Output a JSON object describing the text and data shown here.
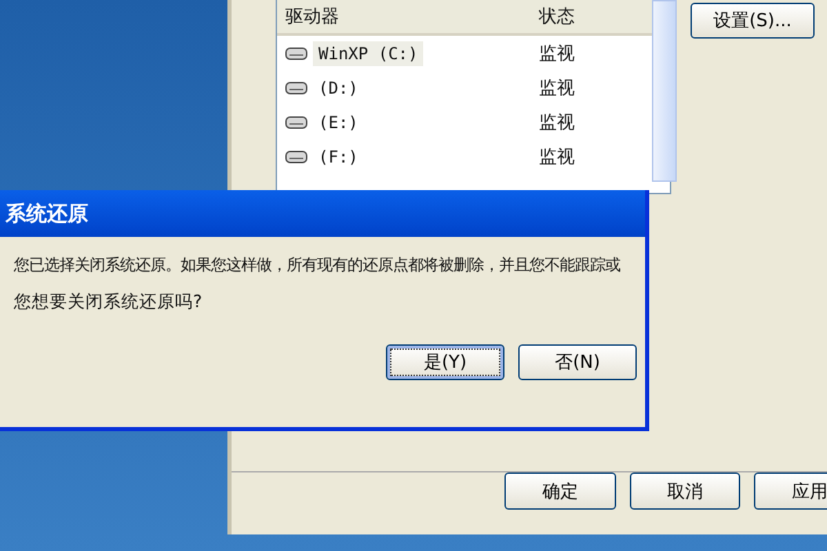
{
  "properties_window": {
    "drive_list": {
      "columns": [
        "驱动器",
        "状态"
      ],
      "rows": [
        {
          "drive": "WinXP (C:)",
          "status": "监视",
          "selected": true
        },
        {
          "drive": "(D:)",
          "status": "监视",
          "selected": false
        },
        {
          "drive": "(E:)",
          "status": "监视",
          "selected": false
        },
        {
          "drive": "(F:)",
          "status": "监视",
          "selected": false
        }
      ]
    },
    "settings_button": "设置(S)...",
    "buttons": [
      "确定",
      "取消",
      "应用"
    ]
  },
  "dialog": {
    "title": "系统还原",
    "message": "您已选择关闭系统还原。如果您这样做，所有现有的还原点都将被删除，并且您不能跟踪或",
    "question": "您想要关闭系统还原吗?",
    "buttons": [
      {
        "label": "是(Y)",
        "selected": true
      },
      {
        "label": "否(N)",
        "selected": false
      }
    ]
  }
}
